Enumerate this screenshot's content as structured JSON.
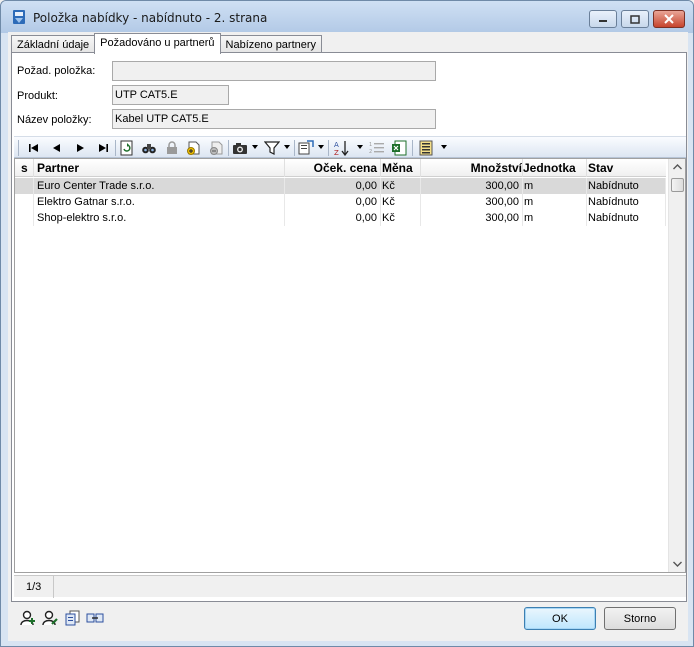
{
  "window": {
    "title": "Položka nabídky - nabídnuto - 2. strana"
  },
  "tabs": [
    {
      "label": "Základní údaje"
    },
    {
      "label": "Požadováno u partnerů"
    },
    {
      "label": "Nabízeno partnery"
    }
  ],
  "fields": {
    "pozad_polozka": {
      "label": "Požad. položka:",
      "value": ""
    },
    "produkt": {
      "label": "Produkt:",
      "value": "UTP CAT5.E"
    },
    "nazev_polozky": {
      "label": "Název položky:",
      "value": "Kabel UTP CAT5.E"
    }
  },
  "grid": {
    "columns": [
      "s",
      "Partner",
      "Oček. cena",
      "Měna",
      "Množství",
      "Jednotka",
      "Stav"
    ],
    "rows": [
      {
        "s": "",
        "partner": "Euro Center Trade s.r.o.",
        "cena": "0,00",
        "mena": "Kč",
        "mnozstvi": "300,00",
        "jednotka": "m",
        "stav": "Nabídnuto"
      },
      {
        "s": "",
        "partner": "Elektro Gatnar s.r.o.",
        "cena": "0,00",
        "mena": "Kč",
        "mnozstvi": "300,00",
        "jednotka": "m",
        "stav": "Nabídnuto"
      },
      {
        "s": "",
        "partner": "Shop-elektro s.r.o.",
        "cena": "0,00",
        "mena": "Kč",
        "mnozstvi": "300,00",
        "jednotka": "m",
        "stav": "Nabídnuto"
      }
    ]
  },
  "status": {
    "record_position": "1/3"
  },
  "buttons": {
    "ok": "OK",
    "cancel": "Storno"
  },
  "icons": {
    "title": "app-form-icon",
    "toolbar": [
      "first-record-icon",
      "prev-record-icon",
      "next-record-icon",
      "last-record-icon",
      "refresh-icon",
      "binoculars-search-icon",
      "lock-icon",
      "add-document-icon",
      "remove-document-icon",
      "camera-icon",
      "filter-icon",
      "export-icon",
      "sort-az-icon",
      "list-number-icon",
      "excel-icon",
      "columns-icon"
    ],
    "bottom": [
      "user-add-icon",
      "user-edit-icon",
      "document-copy-icon",
      "transfer-icon"
    ]
  }
}
